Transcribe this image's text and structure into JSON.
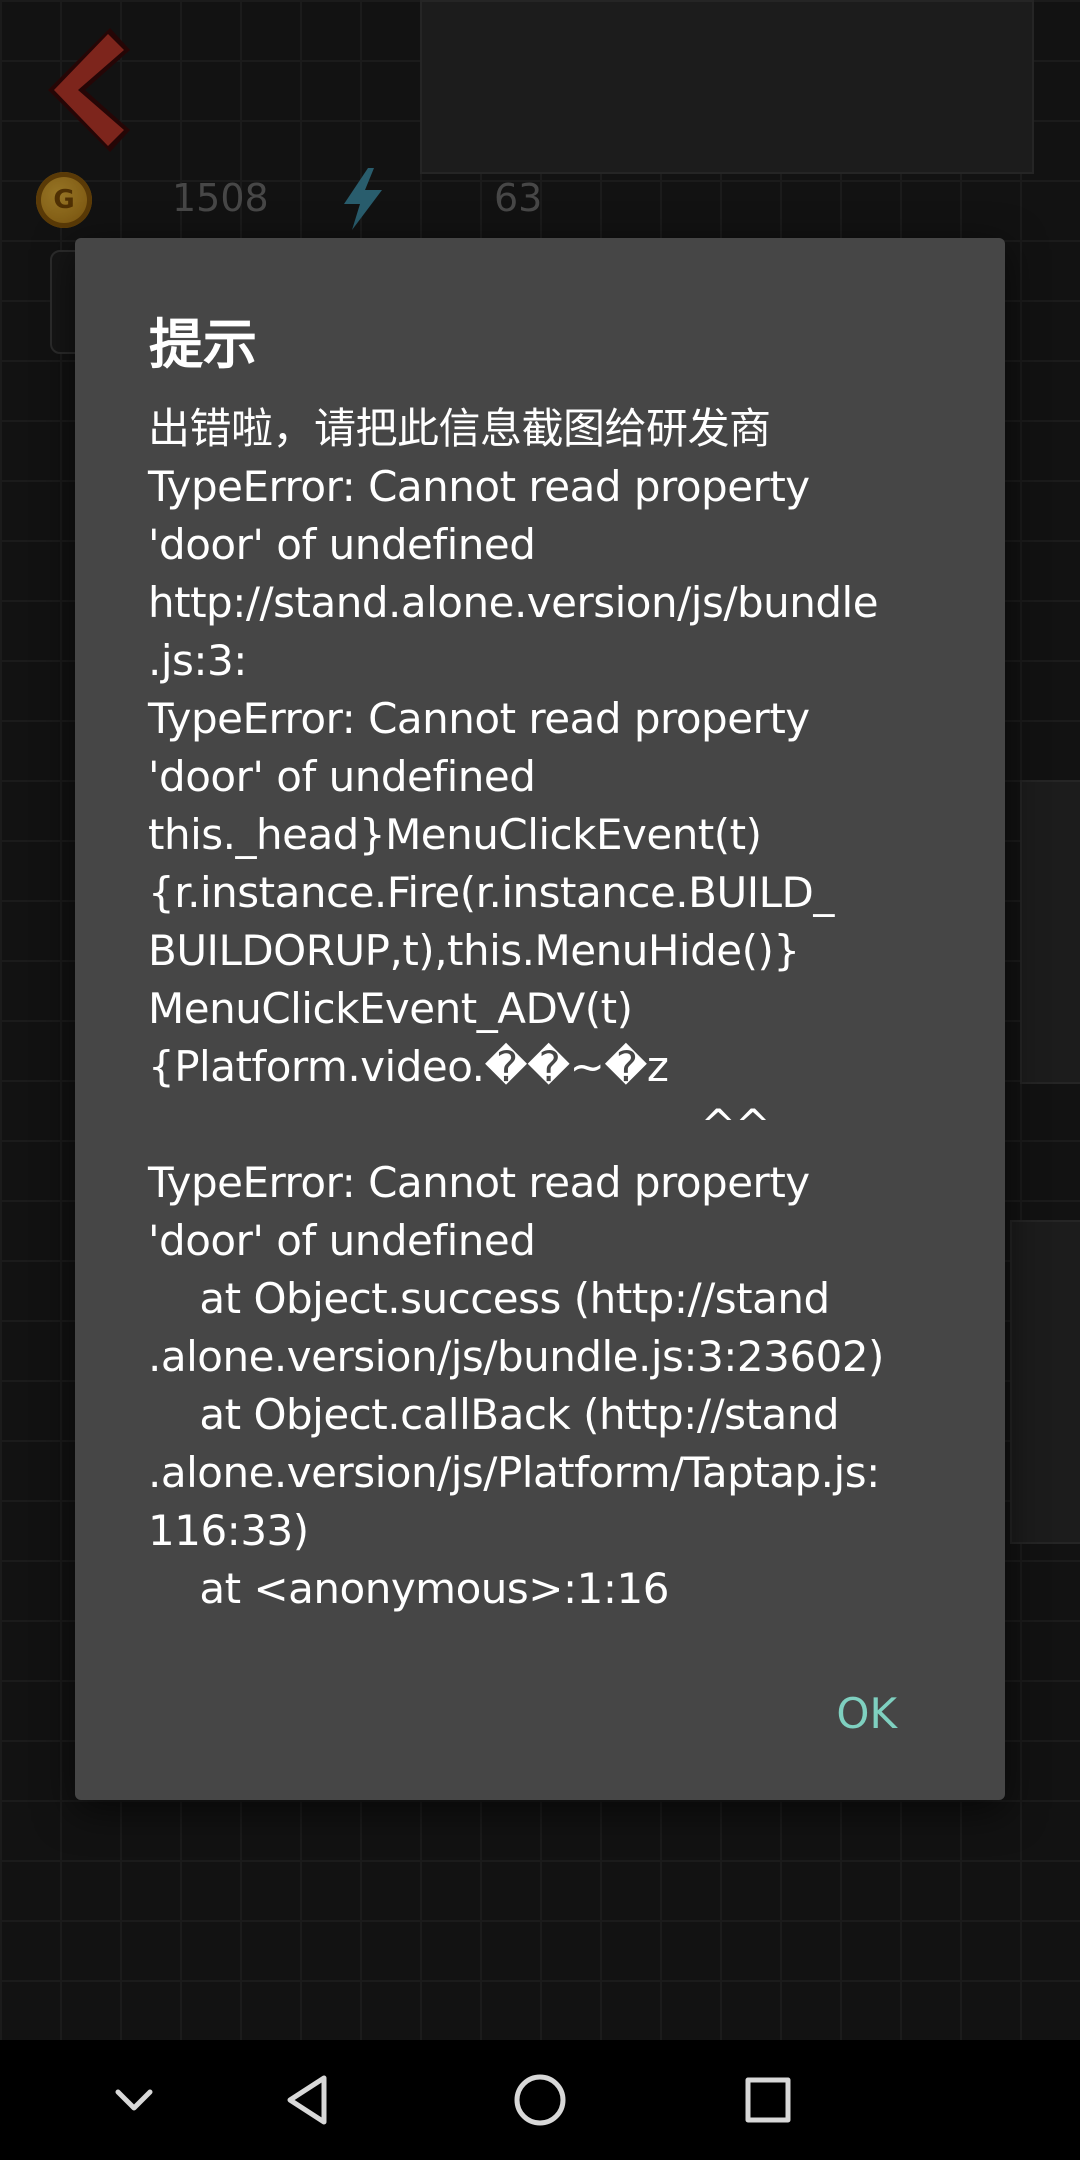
{
  "hud": {
    "coin_label": "G",
    "coins": "1508",
    "energy": "63"
  },
  "dialog": {
    "title": "提示",
    "message": "出错啦，请把此信息截图给研发商\nTypeError: Cannot read property\n'door' of undefined\nhttp://stand.alone.version/js/bundle\n.js:3:\nTypeError: Cannot read property\n'door' of undefined\nthis._head}MenuClickEvent(t)\n{r.instance.Fire(r.instance.BUILD_\nBUILDORUP,t),this.MenuHide()}\nMenuClickEvent_ADV(t)\n{Platform.video.��~�z\n                                           ^^\nTypeError: Cannot read property\n'door' of undefined\n    at Object.success (http://stand\n.alone.version/js/bundle.js:3:23602)\n    at Object.callBack (http://stand\n.alone.version/js/Platform/Taptap.js:\n116:33)\n    at <anonymous>:1:16",
    "ok_label": "OK",
    "accent_color": "#7fd0c0",
    "background_color": "#464646"
  },
  "navbar": {
    "icons": [
      "chevron-down-icon",
      "back-triangle-icon",
      "home-circle-icon",
      "recents-square-icon"
    ]
  }
}
